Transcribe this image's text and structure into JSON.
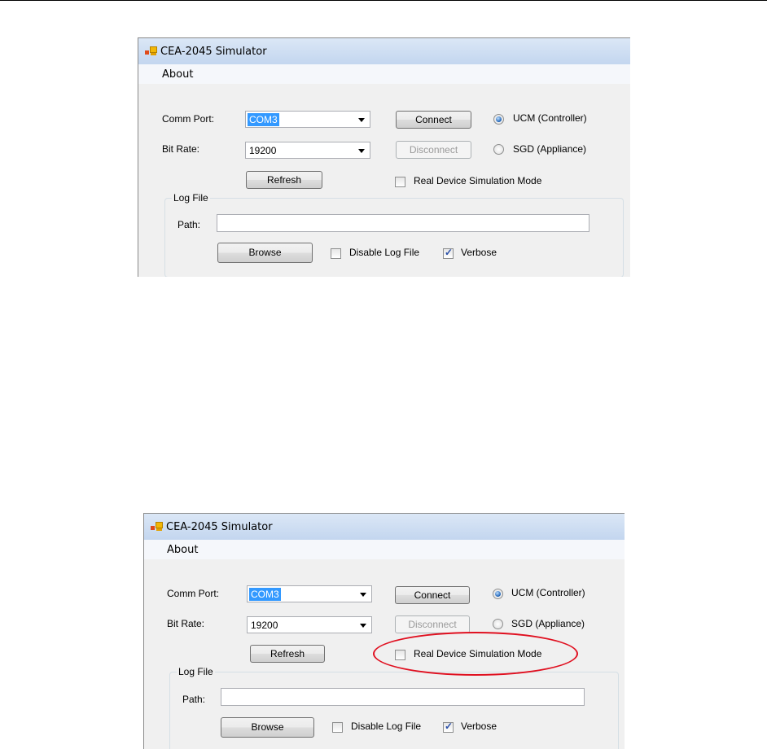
{
  "screenshots": [
    {
      "window": {
        "title": "CEA-2045 Simulator"
      },
      "menu": {
        "about": "About"
      },
      "comm_port": {
        "label": "Comm Port:",
        "value": "COM3"
      },
      "bit_rate": {
        "label": "Bit Rate:",
        "value": "19200"
      },
      "buttons": {
        "connect": "Connect",
        "disconnect": "Disconnect",
        "refresh": "Refresh",
        "browse": "Browse"
      },
      "mode": {
        "ucm": "UCM (Controller)",
        "sgd": "SGD (Appliance)",
        "selected": "ucm"
      },
      "real_device": {
        "label": "Real Device Simulation Mode",
        "checked": false
      },
      "log_file": {
        "group_title": "Log File",
        "path_label": "Path:",
        "path_value": "",
        "disable_label": "Disable Log File",
        "disable_checked": false,
        "verbose_label": "Verbose",
        "verbose_checked": true
      }
    },
    {
      "window": {
        "title": "CEA-2045 Simulator"
      },
      "menu": {
        "about": "About"
      },
      "comm_port": {
        "label": "Comm Port:",
        "value": "COM3"
      },
      "bit_rate": {
        "label": "Bit Rate:",
        "value": "19200"
      },
      "buttons": {
        "connect": "Connect",
        "disconnect": "Disconnect",
        "refresh": "Refresh",
        "browse": "Browse"
      },
      "mode": {
        "ucm": "UCM (Controller)",
        "sgd": "SGD (Appliance)",
        "selected": "ucm"
      },
      "real_device": {
        "label": "Real Device Simulation Mode",
        "checked": false
      },
      "log_file": {
        "group_title": "Log File",
        "path_label": "Path:",
        "path_value": "",
        "disable_label": "Disable Log File",
        "disable_checked": false,
        "verbose_label": "Verbose",
        "verbose_checked": true
      }
    }
  ],
  "annotation": {
    "highlight_color": "#e01020",
    "highlighted_element": "real-device-simulation-checkbox"
  }
}
